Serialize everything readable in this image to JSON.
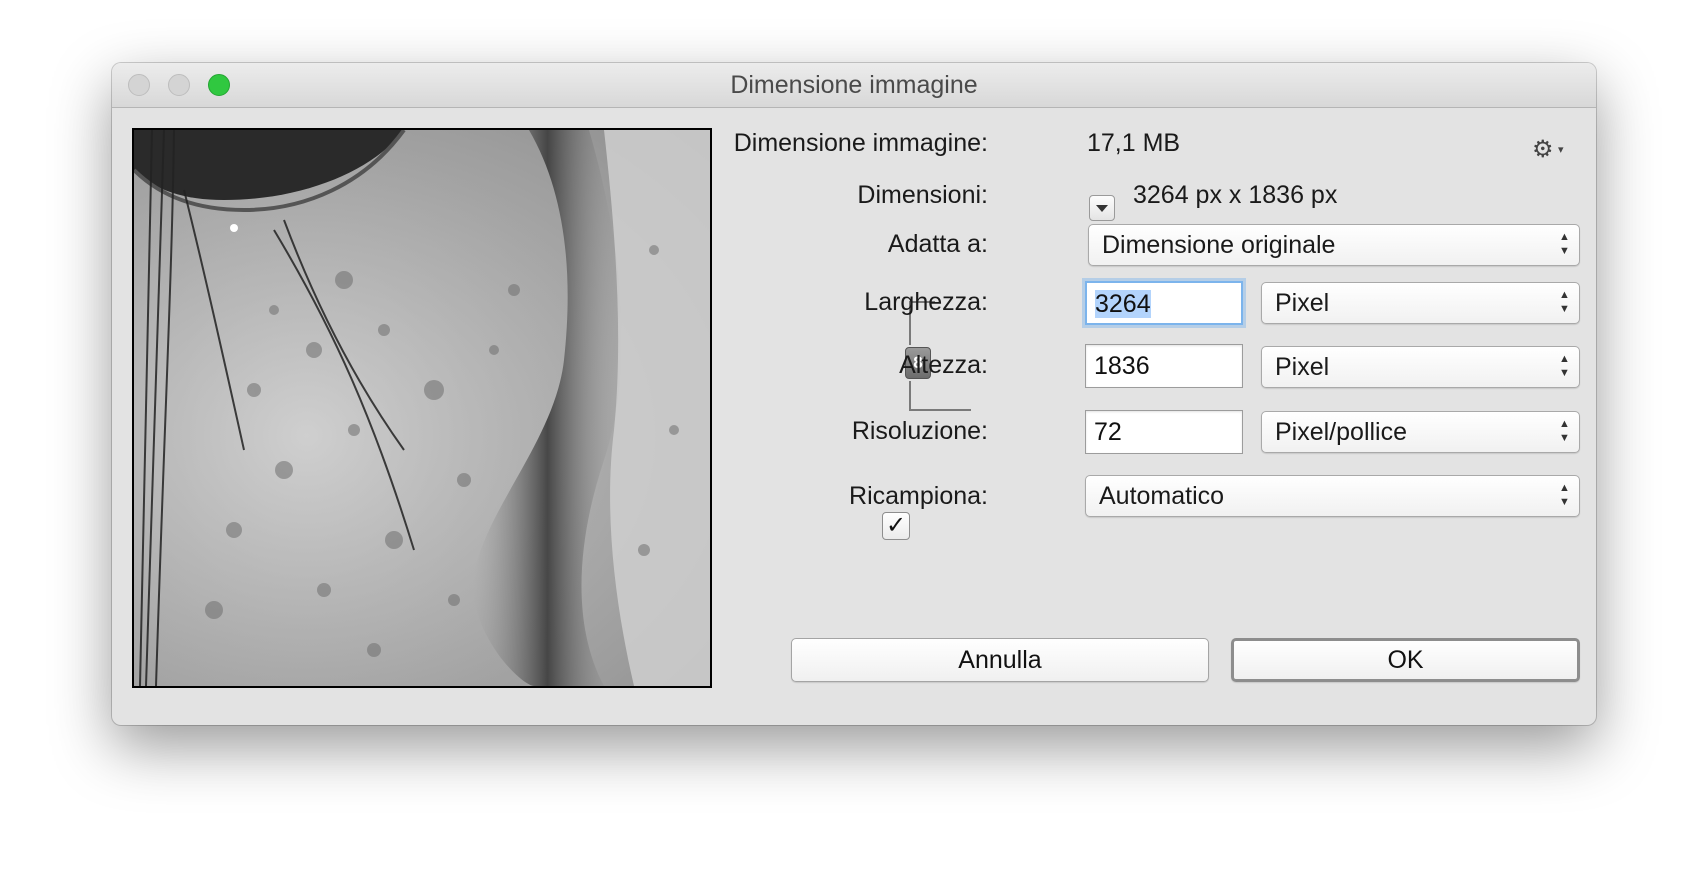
{
  "window": {
    "title": "Dimensione immagine",
    "accent_zoom_color": "#30c840"
  },
  "info": {
    "size_label": "Dimensione immagine:",
    "size_value": "17,1 MB",
    "dims_label": "Dimensioni:",
    "dims_value": "3264 px x 1836 px",
    "settings_icon": "gear-icon"
  },
  "fit": {
    "label": "Adatta a:",
    "value": "Dimensione originale"
  },
  "width": {
    "label": "Larghezza:",
    "value": "3264",
    "unit": "Pixel"
  },
  "height": {
    "label": "Altezza:",
    "value": "1836",
    "unit": "Pixel"
  },
  "resolution": {
    "label": "Risoluzione:",
    "value": "72",
    "unit": "Pixel/pollice"
  },
  "resample": {
    "label": "Ricampiona:",
    "checked": true,
    "value": "Automatico"
  },
  "buttons": {
    "cancel": "Annulla",
    "ok": "OK"
  }
}
